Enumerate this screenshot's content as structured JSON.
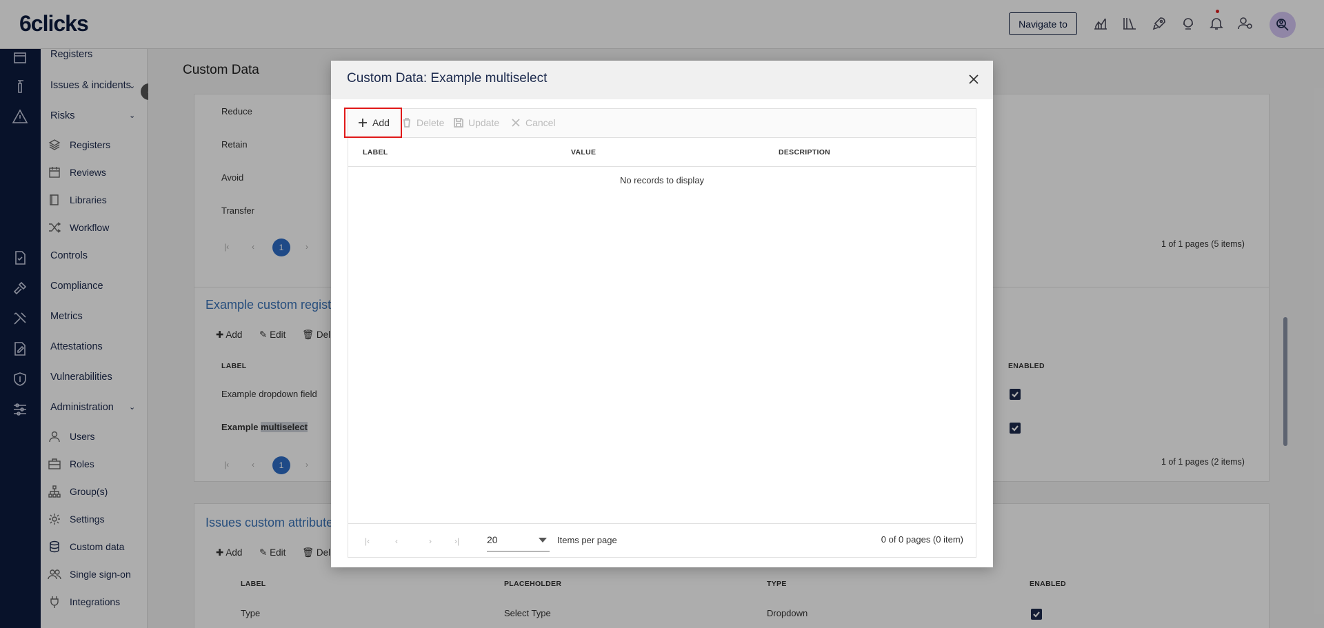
{
  "app": {
    "logo": "6clicks",
    "navigate_label": "Navigate to"
  },
  "sidebar": {
    "items": [
      {
        "label": "Registers"
      },
      {
        "label": "Issues & incidents"
      },
      {
        "label": "Risks"
      },
      {
        "label": "Controls"
      },
      {
        "label": "Compliance"
      },
      {
        "label": "Metrics"
      },
      {
        "label": "Attestations"
      },
      {
        "label": "Vulnerabilities"
      },
      {
        "label": "Administration"
      }
    ],
    "risk_sub": [
      {
        "label": "Registers",
        "icon": "layers-icon"
      },
      {
        "label": "Reviews",
        "icon": "calendar-icon"
      },
      {
        "label": "Libraries",
        "icon": "book-icon"
      },
      {
        "label": "Workflow",
        "icon": "shuffle-icon"
      }
    ],
    "admin_sub": [
      {
        "label": "Users",
        "icon": "user-icon"
      },
      {
        "label": "Roles",
        "icon": "briefcase-icon"
      },
      {
        "label": "Group(s)",
        "icon": "hierarchy-icon"
      },
      {
        "label": "Settings",
        "icon": "gear-icon"
      },
      {
        "label": "Custom data",
        "icon": "database-icon"
      },
      {
        "label": "Single sign-on",
        "icon": "users-icon"
      },
      {
        "label": "Integrations",
        "icon": "plug-icon"
      }
    ]
  },
  "main": {
    "title": "Custom Data",
    "card1": {
      "rows": [
        "Reduce",
        "Retain",
        "Avoid",
        "Transfer"
      ],
      "page": "1",
      "info": "1 of 1 pages (5 items)"
    },
    "card2": {
      "title": "Example custom registe",
      "toolbar": [
        "Add",
        "Edit",
        "Del"
      ],
      "col_label": "LABEL",
      "col_enabled": "ENABLED",
      "rows": [
        "Example dropdown field",
        "Example multiselect"
      ],
      "row2_prefix": "Example ",
      "row2_highlight": "multiselect",
      "page": "1",
      "info": "1 of 1 pages (2 items)"
    },
    "card3": {
      "title": "Issues custom attribute",
      "toolbar": [
        "Add",
        "Edit",
        "Del"
      ],
      "cols": [
        "LABEL",
        "PLACEHOLDER",
        "TYPE",
        "ENABLED"
      ],
      "row": [
        "Type",
        "Select Type",
        "Dropdown"
      ]
    }
  },
  "modal": {
    "title": "Custom Data: Example multiselect",
    "toolbar": {
      "add": "Add",
      "delete": "Delete",
      "update": "Update",
      "cancel": "Cancel"
    },
    "columns": {
      "label": "LABEL",
      "value": "VALUE",
      "description": "DESCRIPTION"
    },
    "empty_text": "No records to display",
    "page_size": "20",
    "per_page_label": "Items per page",
    "pager_info": "0 of 0 pages (0 item)"
  }
}
